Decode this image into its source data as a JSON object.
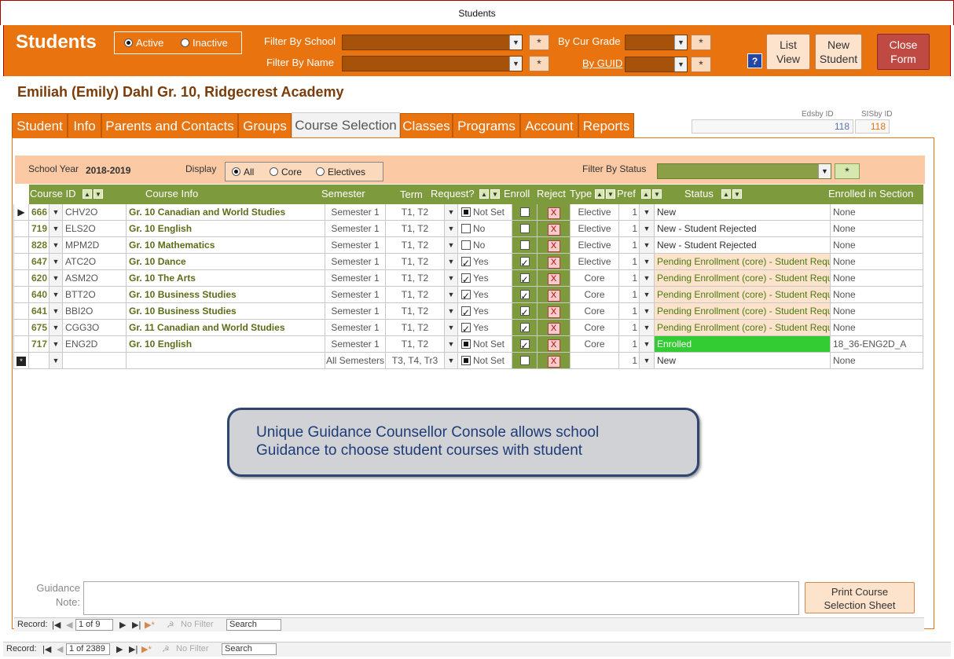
{
  "window": {
    "title": "Students"
  },
  "header": {
    "title": "Students",
    "active_label": "Active",
    "inactive_label": "Inactive",
    "filter_school_label": "Filter By School",
    "filter_name_label": "Filter By Name",
    "cur_grade_label": "By Cur Grade",
    "guid_label": "By GUID",
    "star": "*",
    "help": "?",
    "list_view": [
      "List",
      "View"
    ],
    "new_student": [
      "New",
      "Student"
    ],
    "close_form": [
      "Close",
      "Form"
    ]
  },
  "student": {
    "name_line": "Emiliah (Emily)  Dahl  Gr. 10, Ridgecrest Academy",
    "edsby_label": "Edsby ID",
    "sisby_label": "SISby ID",
    "edsby_id": "118",
    "sisby_id": "118"
  },
  "tabs": [
    "Student",
    "Info",
    "Parents and Contacts",
    "Groups",
    "Course Selection",
    "Classes",
    "Programs",
    "Account",
    "Reports"
  ],
  "filters": {
    "school_year_label": "School Year",
    "school_year": "2018-2019",
    "display_label": "Display",
    "display_all": "All",
    "display_core": "Core",
    "display_electives": "Electives",
    "status_label": "Filter By Status",
    "star": "*"
  },
  "columns": {
    "course_id": "Course ID",
    "course_info": "Course Info",
    "semester": "Semester",
    "term": "Term",
    "request": "Request?",
    "enroll": "Enroll",
    "reject": "Reject",
    "type": "Type",
    "pref": "Pref",
    "status": "Status",
    "enrolled_section": "Enrolled in Section"
  },
  "rows": [
    {
      "num": "666",
      "code": "CHV2O",
      "info": "Gr. 10 Canadian and World Studies",
      "semester": "Semester 1",
      "term": "T1, T2",
      "request": "Not Set",
      "req_state": "sq",
      "enroll": false,
      "type": "Elective",
      "pref": "1",
      "status": "New",
      "status_kind": "new",
      "section": "None"
    },
    {
      "num": "719",
      "code": "ELS2O",
      "info": "Gr. 10 English",
      "semester": "Semester 1",
      "term": "T1, T2",
      "request": "No",
      "req_state": "off",
      "enroll": false,
      "type": "Elective",
      "pref": "1",
      "status": "New - Student Rejected",
      "status_kind": "new",
      "section": "None"
    },
    {
      "num": "828",
      "code": "MPM2D",
      "info": "Gr. 10 Mathematics",
      "semester": "Semester 1",
      "term": "T1, T2",
      "request": "No",
      "req_state": "off",
      "enroll": false,
      "type": "Elective",
      "pref": "1",
      "status": "New - Student Rejected",
      "status_kind": "new",
      "section": "None"
    },
    {
      "num": "647",
      "code": "ATC2O",
      "info": "Gr. 10 Dance",
      "semester": "Semester 1",
      "term": "T1, T2",
      "request": "Yes",
      "req_state": "on",
      "enroll": true,
      "type": "Elective",
      "pref": "1",
      "status": "Pending Enrollment (core) - Student Requ",
      "status_kind": "pend",
      "section": "None"
    },
    {
      "num": "620",
      "code": "ASM2O",
      "info": "Gr. 10 The Arts",
      "semester": "Semester 1",
      "term": "T1, T2",
      "request": "Yes",
      "req_state": "on",
      "enroll": true,
      "type": "Core",
      "pref": "1",
      "status": "Pending Enrollment (core) - Student Requ",
      "status_kind": "pend",
      "section": "None"
    },
    {
      "num": "640",
      "code": "BTT2O",
      "info": "Gr. 10 Business Studies",
      "semester": "Semester 1",
      "term": "T1, T2",
      "request": "Yes",
      "req_state": "on",
      "enroll": true,
      "type": "Core",
      "pref": "1",
      "status": "Pending Enrollment (core) - Student Requ",
      "status_kind": "pend",
      "section": "None"
    },
    {
      "num": "641",
      "code": "BBI2O",
      "info": "Gr. 10 Business Studies",
      "semester": "Semester 1",
      "term": "T1, T2",
      "request": "Yes",
      "req_state": "on",
      "enroll": true,
      "type": "Core",
      "pref": "1",
      "status": "Pending Enrollment (core) - Student Requ",
      "status_kind": "pend",
      "section": "None"
    },
    {
      "num": "675",
      "code": "CGG3O",
      "info": "Gr. 11 Canadian and World Studies",
      "semester": "Semester 1",
      "term": "T1, T2",
      "request": "Yes",
      "req_state": "on",
      "enroll": true,
      "type": "Core",
      "pref": "1",
      "status": "Pending Enrollment (core) - Student Requ",
      "status_kind": "pend",
      "section": "None"
    },
    {
      "num": "717",
      "code": "ENG2D",
      "info": "Gr. 10 English",
      "semester": "Semester 1",
      "term": "T1, T2",
      "request": "Not Set",
      "req_state": "sq",
      "enroll": true,
      "type": "Core",
      "pref": "1",
      "status": "Enrolled",
      "status_kind": "enr",
      "section": "18_36-ENG2D_A"
    },
    {
      "num": "",
      "code": "",
      "info": "",
      "semester": "All Semesters",
      "term": "T3, T4, Tr3",
      "request": "Not Set",
      "req_state": "sq",
      "enroll": false,
      "type": "",
      "pref": "1",
      "status": "New",
      "status_kind": "new",
      "section": "None"
    }
  ],
  "callout": [
    "Unique Guidance Counsellor Console allows school",
    "Guidance to choose student courses with student"
  ],
  "guidance": {
    "label_1": "Guidance",
    "label_2": "Note:",
    "print_btn": [
      "Print Course",
      "Selection Sheet"
    ]
  },
  "subnav": {
    "label": "Record:",
    "position": "1 of 9",
    "filter": "No Filter",
    "search": "Search"
  },
  "mainnav": {
    "label": "Record:",
    "position": "1 of 2389",
    "filter": "No Filter",
    "search": "Search"
  },
  "colors": {
    "orange": "#e8730f",
    "green": "#7d9a3c",
    "enrolled": "#33cc33",
    "close": "#bf4a44"
  },
  "icons": {
    "dropdown": "chevron-down-icon",
    "sort": "sort-arrows-icon",
    "reject": "x-icon",
    "record_selector": "triangle-right-icon"
  }
}
